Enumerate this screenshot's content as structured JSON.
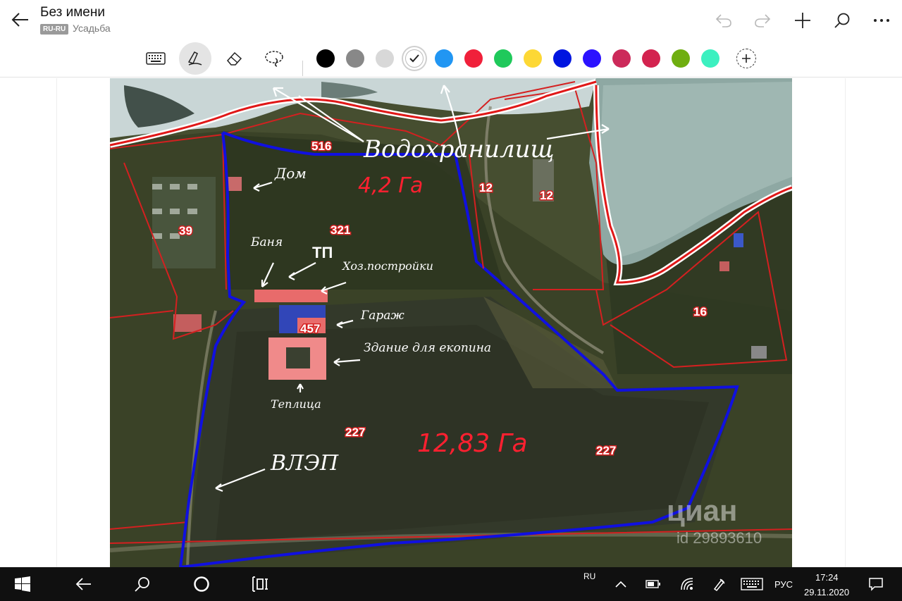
{
  "window": {
    "title": "Без имени",
    "lang_badge": "RU-RU",
    "notebook": "Усадьба"
  },
  "toolbar": {
    "icons": [
      "back-arrow-icon",
      "undo-icon",
      "redo-icon",
      "plus-icon",
      "search-icon",
      "more-icon"
    ]
  },
  "ink_tools": [
    "keyboard-icon",
    "pen-icon",
    "eraser-icon",
    "lasso-icon"
  ],
  "colors": [
    "#000000",
    "#888888",
    "#d8d8d8",
    "#ffffff",
    "#2196f3",
    "#f0203a",
    "#1fc95b",
    "#fdd835",
    "#0015e0",
    "#2b12ff",
    "#cc2a5a",
    "#d3234f",
    "#6fae10",
    "#3cf0c0"
  ],
  "selected_color": "#ffffff",
  "map": {
    "labels": {
      "p516": "516",
      "p12a": "12",
      "p12b": "12",
      "p39": "39",
      "p321": "321",
      "p457": "457",
      "p227a": "227",
      "p227b": "227",
      "p16": "16"
    },
    "annotations": {
      "reservoirs": "Водохранилищ",
      "area1": "4,2 Га",
      "area2": "12,83 Га",
      "house": "Дом",
      "bath": "Баня",
      "tp": "ТП",
      "outbuildings": "Хоз.постройки",
      "garage": "Гараж",
      "building": "Здание для екопина",
      "greenhouse": "Теплица",
      "vlep": "ВЛЭП"
    },
    "watermark": "циан",
    "watermark_id": "id 29893610"
  },
  "taskbar": {
    "lang_small": "RU",
    "lang": "РУС",
    "time": "17:24",
    "date": "29.11.2020"
  }
}
